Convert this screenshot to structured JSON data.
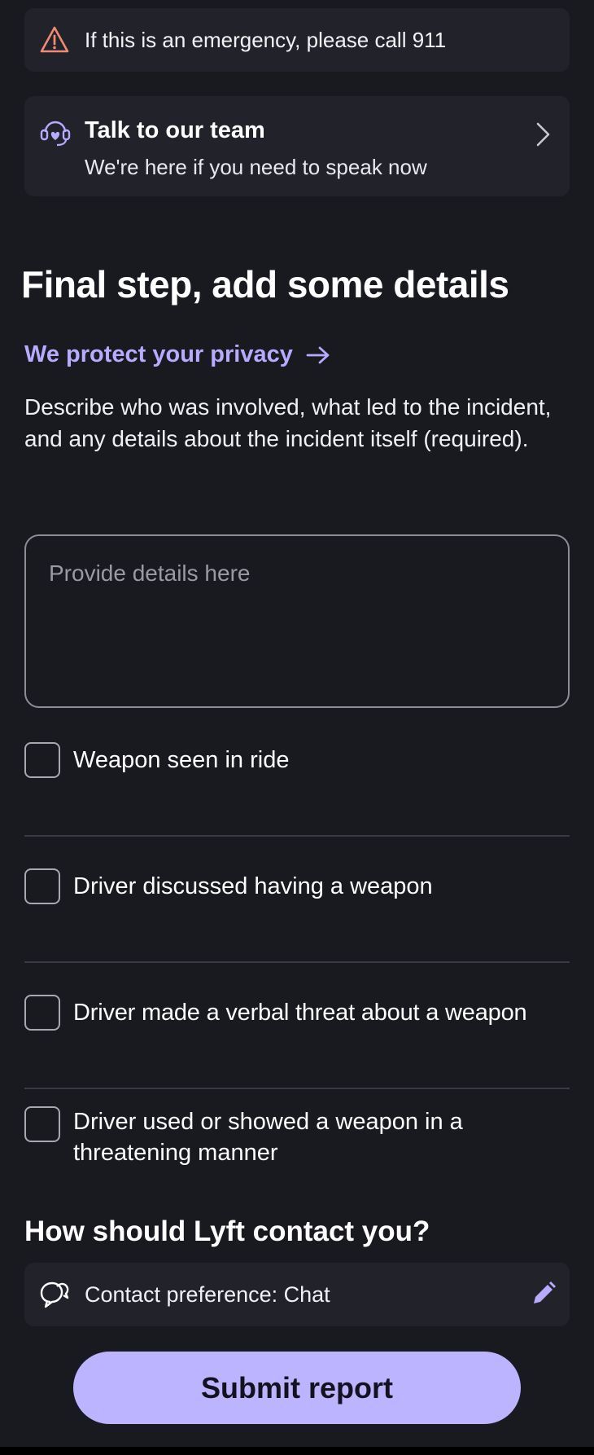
{
  "emergency": {
    "text": "If this is an emergency, please call 911",
    "icon": "warning-icon",
    "icon_color": "#f08a72"
  },
  "team": {
    "title": "Talk to our team",
    "subtitle": "We're here if you need to speak now",
    "icon": "headset-icon",
    "chevron": "chevron-right-icon"
  },
  "main": {
    "heading": "Final step, add some details",
    "privacy_link": "We protect your privacy",
    "description": "Describe who was involved, what led to the incident, and any details about the incident itself (required).",
    "details_placeholder": "Provide details here",
    "details_value": ""
  },
  "checkboxes": [
    {
      "label": "Weapon seen in ride",
      "checked": false
    },
    {
      "label": "Driver discussed having a weapon",
      "checked": false
    },
    {
      "label": "Driver made a verbal threat about a weapon",
      "checked": false
    },
    {
      "label": "Driver used or showed a weapon in a threatening manner",
      "checked": false
    }
  ],
  "contact": {
    "heading": "How should Lyft contact you?",
    "preference": "Contact preference: Chat",
    "icon": "chat-bubbles-icon",
    "edit_icon": "pencil-icon"
  },
  "submit_label": "Submit report",
  "colors": {
    "background": "#191920",
    "card": "#22222b",
    "accent": "#b7aaff",
    "button": "#bdb4ff"
  }
}
